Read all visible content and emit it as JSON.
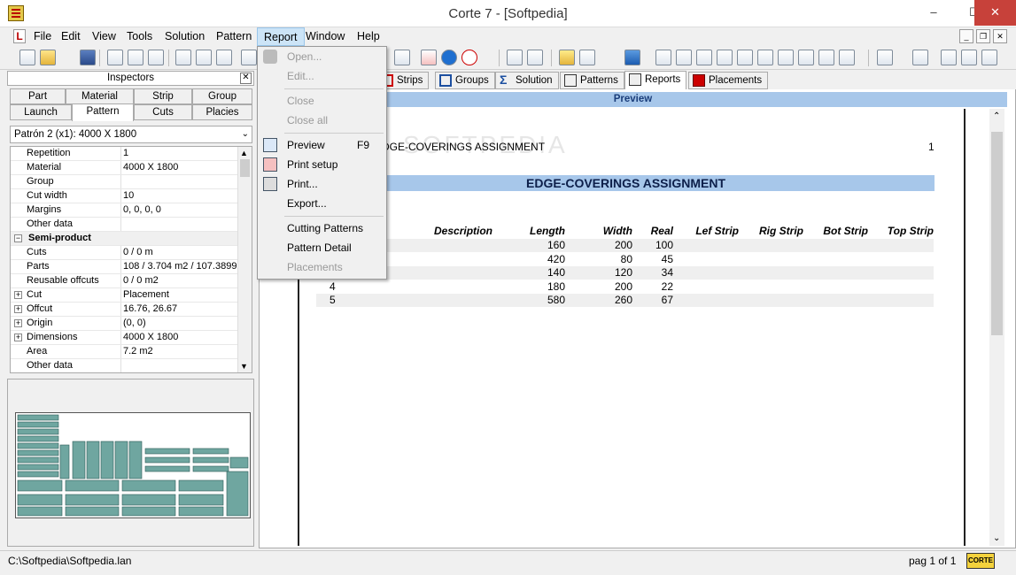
{
  "window": {
    "title": "Corte 7 - [Softpedia]",
    "minimize": "–",
    "maximize": "☐",
    "close": "✕"
  },
  "menu": [
    "File",
    "Edit",
    "View",
    "Tools",
    "Solution",
    "Pattern",
    "Report",
    "Window",
    "Help"
  ],
  "mdi_controls": [
    "_",
    "❐",
    "✕"
  ],
  "report_menu": {
    "items": [
      {
        "label": "Open...",
        "enabled": false,
        "shortcut": ""
      },
      {
        "label": "Edit...",
        "enabled": false,
        "shortcut": ""
      },
      {
        "label": "Close",
        "enabled": false,
        "shortcut": ""
      },
      {
        "label": "Close all",
        "enabled": false,
        "shortcut": ""
      },
      {
        "label": "Preview",
        "enabled": true,
        "shortcut": "F9"
      },
      {
        "label": "Print setup",
        "enabled": true,
        "shortcut": ""
      },
      {
        "label": "Print...",
        "enabled": true,
        "shortcut": ""
      },
      {
        "label": "Export...",
        "enabled": true,
        "shortcut": ""
      },
      {
        "label": "Cutting Patterns",
        "enabled": true,
        "shortcut": ""
      },
      {
        "label": "Pattern Detail",
        "enabled": true,
        "shortcut": ""
      },
      {
        "label": "Placements",
        "enabled": false,
        "shortcut": ""
      }
    ]
  },
  "inspectors": {
    "title": "Inspectors",
    "tabs_row1": [
      "Part",
      "Material",
      "Strip",
      "Group"
    ],
    "tabs_row2": [
      "Launch",
      "Pattern",
      "Cuts",
      "Placies"
    ],
    "selected_tab": "Pattern",
    "combo": "Patrón 2 (x1): 4000 X 1800",
    "properties": [
      {
        "key": "Repetition",
        "value": "1",
        "expander": ""
      },
      {
        "key": "Material",
        "value": "4000 X 1800",
        "expander": ""
      },
      {
        "key": "Group",
        "value": "",
        "expander": ""
      },
      {
        "key": "Cut width",
        "value": "10",
        "expander": ""
      },
      {
        "key": "Margins",
        "value": "0, 0, 0, 0",
        "expander": ""
      },
      {
        "key": "Other data",
        "value": "",
        "expander": ""
      },
      {
        "key": "Semi-product",
        "value": "",
        "expander": "−",
        "section": true
      },
      {
        "key": "Cuts",
        "value": "0 / 0 m",
        "expander": ""
      },
      {
        "key": "Parts",
        "value": "108 / 3.704 m2 / 107.3899",
        "expander": ""
      },
      {
        "key": "Reusable offcuts",
        "value": "0 / 0 m2",
        "expander": ""
      },
      {
        "key": "Cut",
        "value": "Placement",
        "expander": "+"
      },
      {
        "key": "Offcut",
        "value": "16.76, 26.67",
        "expander": "+"
      },
      {
        "key": "Origin",
        "value": "(0, 0)",
        "expander": "+"
      },
      {
        "key": "Dimensions",
        "value": "4000 X 1800",
        "expander": "+"
      },
      {
        "key": "Area",
        "value": "7.2 m2",
        "expander": ""
      },
      {
        "key": "Other data",
        "value": "",
        "expander": ""
      }
    ]
  },
  "doc_tabs": [
    "Strips",
    "Groups",
    "Solution",
    "Patterns",
    "Reports",
    "Placements"
  ],
  "selected_doc_tab": "Reports",
  "preview_label": "Preview",
  "report": {
    "header_title": "EDGE-COVERINGS ASSIGNMENT",
    "header_page": "1",
    "banner_title": "EDGE-COVERINGS ASSIGNMENT",
    "columns": [
      "Description",
      "Length",
      "Width",
      "Real",
      "Lef Strip",
      "Rig Strip",
      "Bot Strip",
      "Top Strip"
    ],
    "rows": [
      {
        "id": "",
        "length": "160",
        "width": "200",
        "real": "100"
      },
      {
        "id": "",
        "length": "420",
        "width": "80",
        "real": "45"
      },
      {
        "id": "",
        "length": "140",
        "width": "120",
        "real": "34"
      },
      {
        "id": "4",
        "length": "180",
        "width": "200",
        "real": "22"
      },
      {
        "id": "5",
        "length": "580",
        "width": "260",
        "real": "67"
      }
    ],
    "watermark": "SOFTPEDIA"
  },
  "status": {
    "path": "C:\\Softpedia\\Softpedia.lan",
    "page": "pag 1 of 1",
    "logo": "CORTE"
  },
  "colors": {
    "preview_bar": "#a7c7ea",
    "banner": "#a7c7ea",
    "close_btn": "#c7413a",
    "thumb_parts": "#6fa6a0"
  }
}
